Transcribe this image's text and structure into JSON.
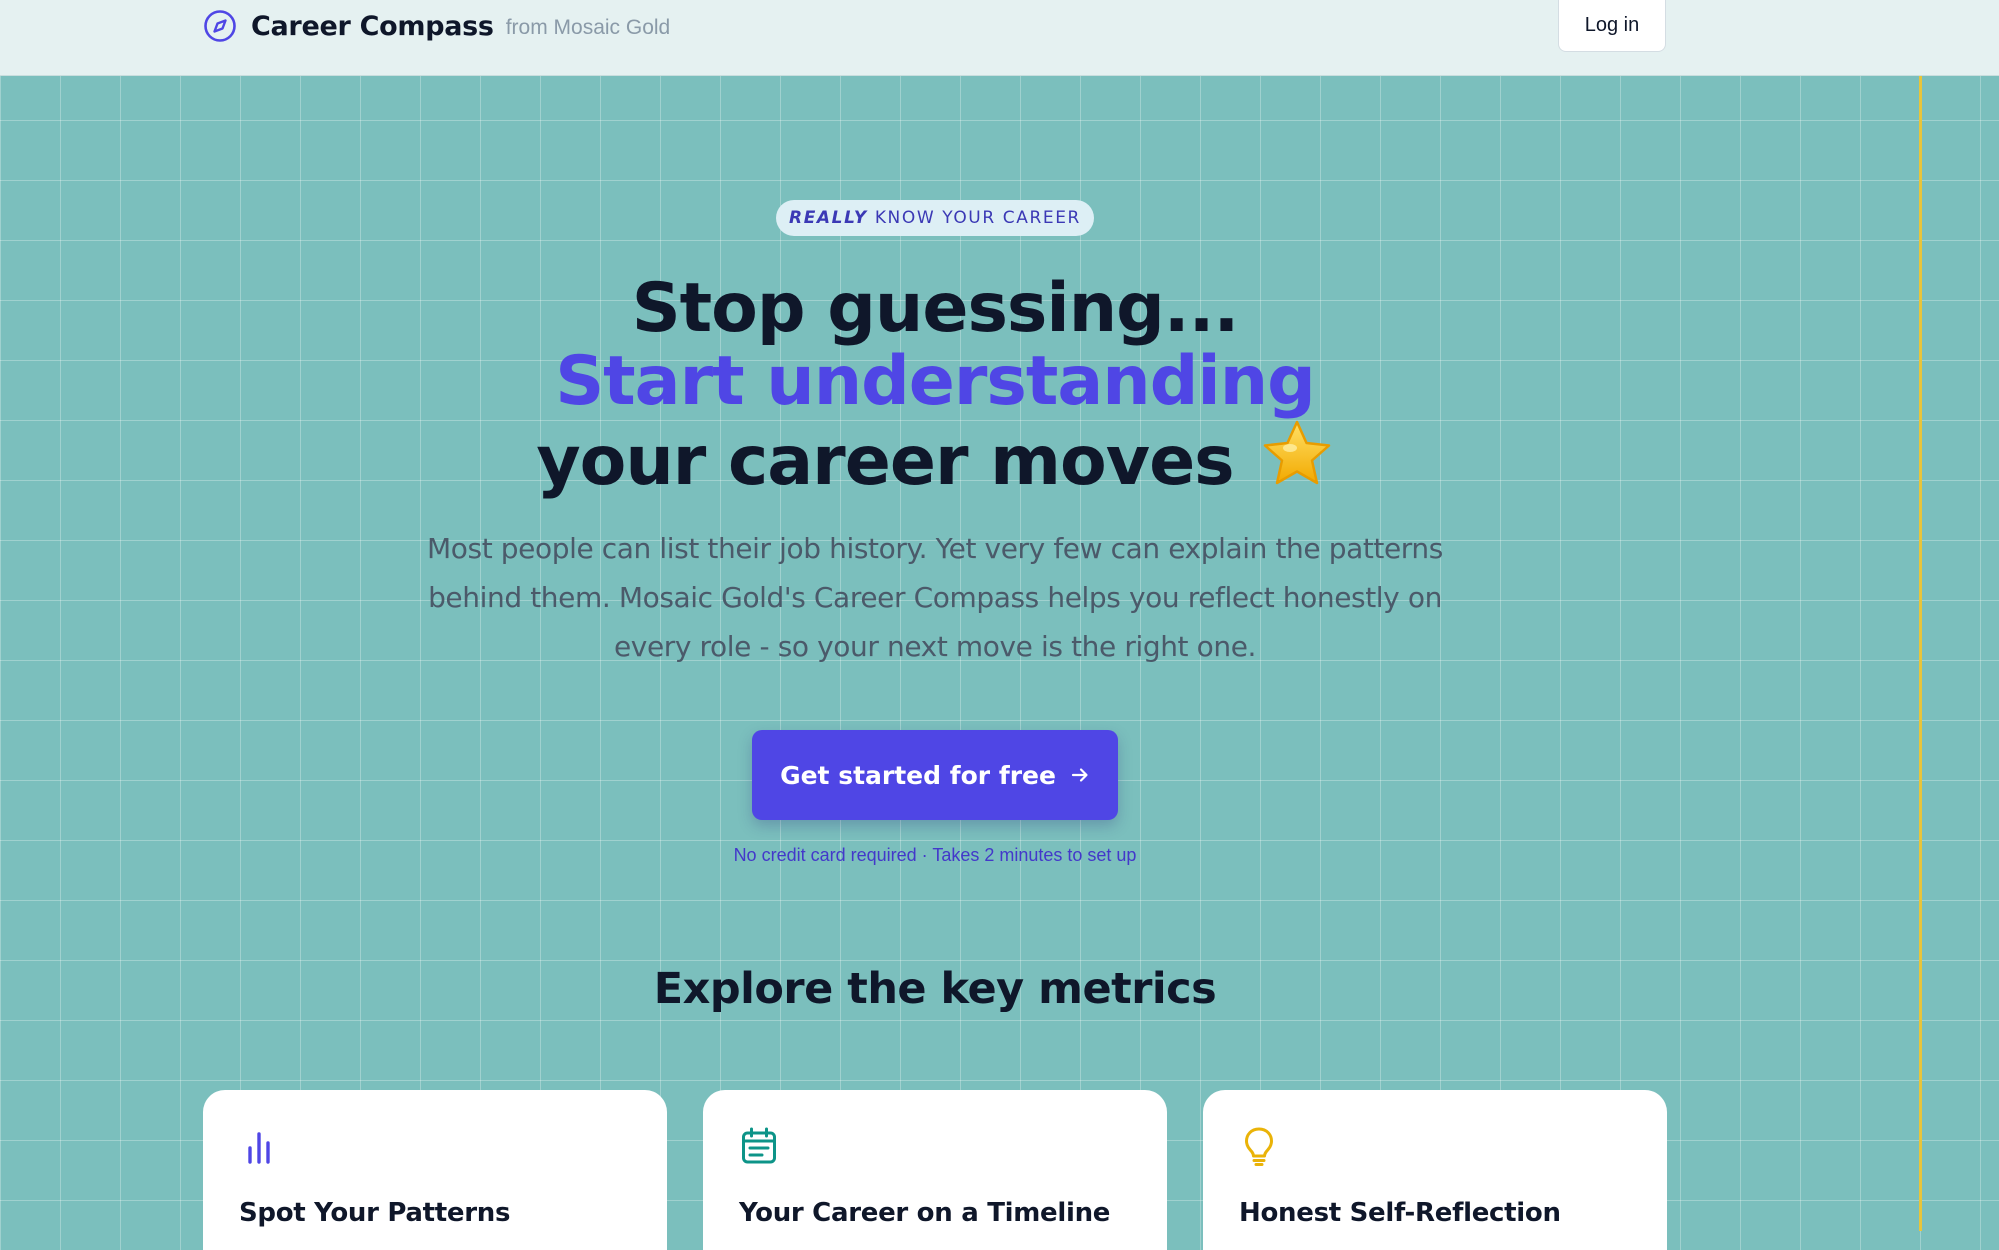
{
  "header": {
    "brand_name": "Career Compass",
    "brand_from": "from Mosaic Gold",
    "login_label": "Log in"
  },
  "hero": {
    "eyebrow_emphasis": "REALLY",
    "eyebrow_rest": "KNOW YOUR CAREER",
    "headline_line1": "Stop guessing...",
    "headline_line2": "Start understanding",
    "headline_line3": "your career moves",
    "subtext": "Most people can list their job history. Yet very few can explain the patterns behind them. Mosaic Gold's Career Compass helps you reflect honestly on every role - so your next move is the right one.",
    "cta_label": "Get started for free",
    "cta_note": "No credit card required · Takes 2 minutes to set up"
  },
  "metrics": {
    "section_title": "Explore the key metrics",
    "cards": [
      {
        "title": "Spot Your Patterns",
        "icon": "bar-chart-icon"
      },
      {
        "title": "Your Career on a Timeline",
        "icon": "calendar-icon"
      },
      {
        "title": "Honest Self-Reflection",
        "icon": "lightbulb-icon"
      }
    ]
  },
  "colors": {
    "background": "#7bbfbd",
    "accent": "#4f46e5",
    "gold": "#e8c53a",
    "teal_icon": "#0d9488"
  }
}
